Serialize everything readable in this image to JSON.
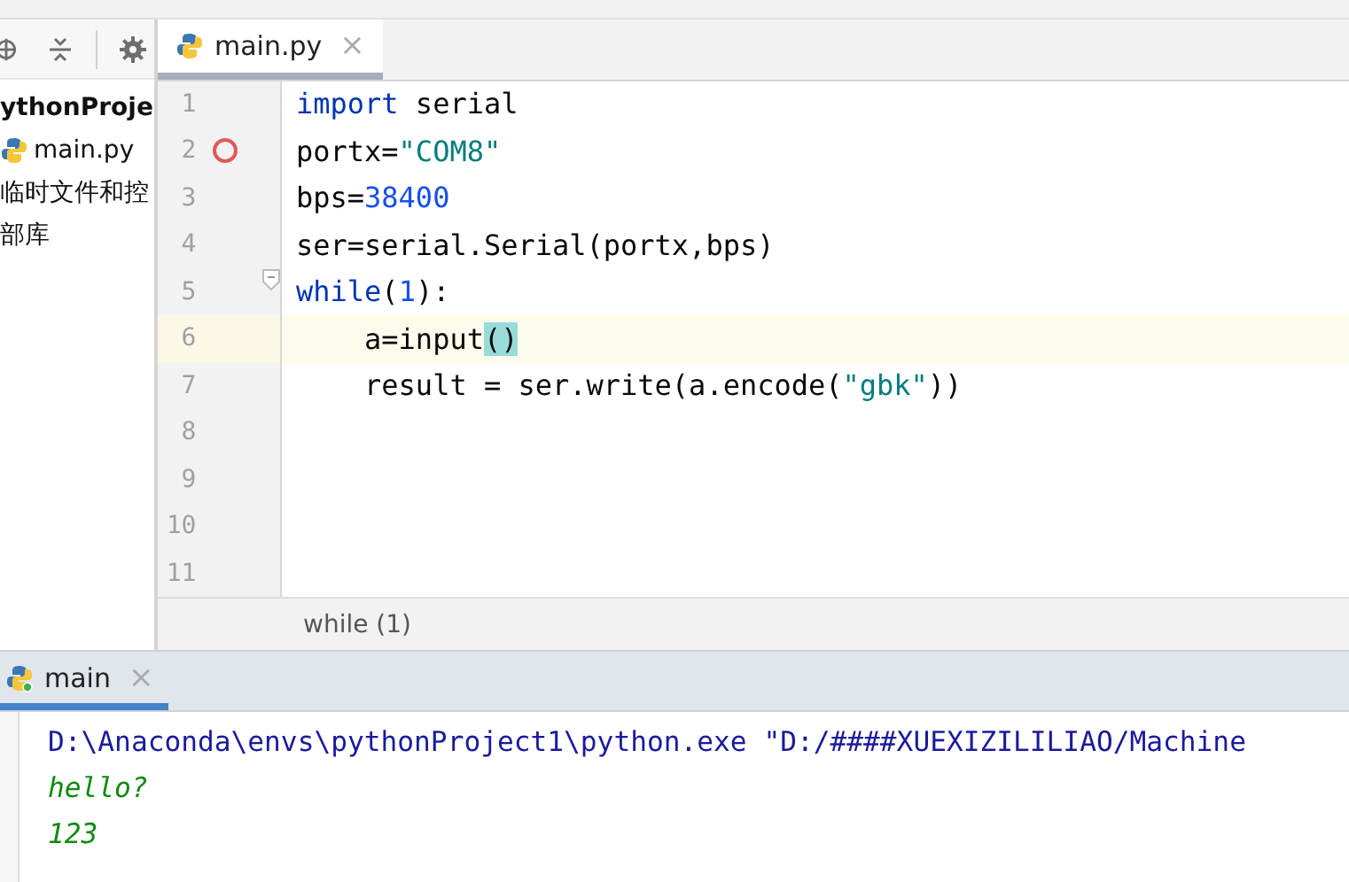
{
  "project_panel": {
    "items": [
      {
        "label": "ythonProje",
        "kind": "root"
      },
      {
        "label": "main.py",
        "kind": "file"
      },
      {
        "label": "临时文件和控",
        "kind": "plain"
      },
      {
        "label": "部库",
        "kind": "plain"
      }
    ]
  },
  "editor": {
    "tabs": [
      {
        "label": "main.py",
        "selected": true,
        "close": "×"
      }
    ],
    "lines": [
      {
        "number": "1",
        "current": false,
        "breakpoint": false,
        "fold": false,
        "tokens": [
          {
            "kind": "kw",
            "text": "import"
          },
          {
            "kind": "plain",
            "text": " serial"
          }
        ]
      },
      {
        "number": "2",
        "current": false,
        "breakpoint": true,
        "fold": false,
        "tokens": [
          {
            "kind": "plain",
            "text": "portx="
          },
          {
            "kind": "str",
            "text": "\"COM8\""
          }
        ]
      },
      {
        "number": "3",
        "current": false,
        "breakpoint": false,
        "fold": false,
        "tokens": [
          {
            "kind": "plain",
            "text": "bps="
          },
          {
            "kind": "num",
            "text": "38400"
          }
        ]
      },
      {
        "number": "4",
        "current": false,
        "breakpoint": false,
        "fold": false,
        "tokens": [
          {
            "kind": "plain",
            "text": "ser=serial.Serial(portx,bps)"
          }
        ]
      },
      {
        "number": "5",
        "current": false,
        "breakpoint": false,
        "fold": true,
        "tokens": [
          {
            "kind": "kw",
            "text": "while"
          },
          {
            "kind": "plain",
            "text": "("
          },
          {
            "kind": "num",
            "text": "1"
          },
          {
            "kind": "plain",
            "text": "):"
          }
        ]
      },
      {
        "number": "6",
        "current": true,
        "breakpoint": false,
        "fold": false,
        "tokens": [
          {
            "kind": "plain",
            "text": "    a=input"
          },
          {
            "kind": "match",
            "text": "()"
          }
        ]
      },
      {
        "number": "7",
        "current": false,
        "breakpoint": false,
        "fold": false,
        "tokens": [
          {
            "kind": "plain",
            "text": "    result = ser.write(a.encode("
          },
          {
            "kind": "str",
            "text": "\"gbk\""
          },
          {
            "kind": "plain",
            "text": "))"
          }
        ]
      },
      {
        "number": "8",
        "current": false,
        "breakpoint": false,
        "fold": false
      },
      {
        "number": "9",
        "current": false,
        "breakpoint": false,
        "fold": false
      },
      {
        "number": "10",
        "current": false,
        "breakpoint": false,
        "fold": false
      },
      {
        "number": "11",
        "current": false,
        "breakpoint": false,
        "fold": false
      }
    ],
    "breadcrumb": "while (1)"
  },
  "run_panel": {
    "tabs": [
      {
        "label": "main",
        "selected": true,
        "close": "×"
      }
    ],
    "output": [
      {
        "kind": "command",
        "text": "D:\\Anaconda\\envs\\pythonProject1\\python.exe \"D:/####XUEXIZILILIAO/Machine"
      },
      {
        "kind": "input",
        "text": "hello?"
      },
      {
        "kind": "input",
        "text": "123"
      }
    ]
  }
}
